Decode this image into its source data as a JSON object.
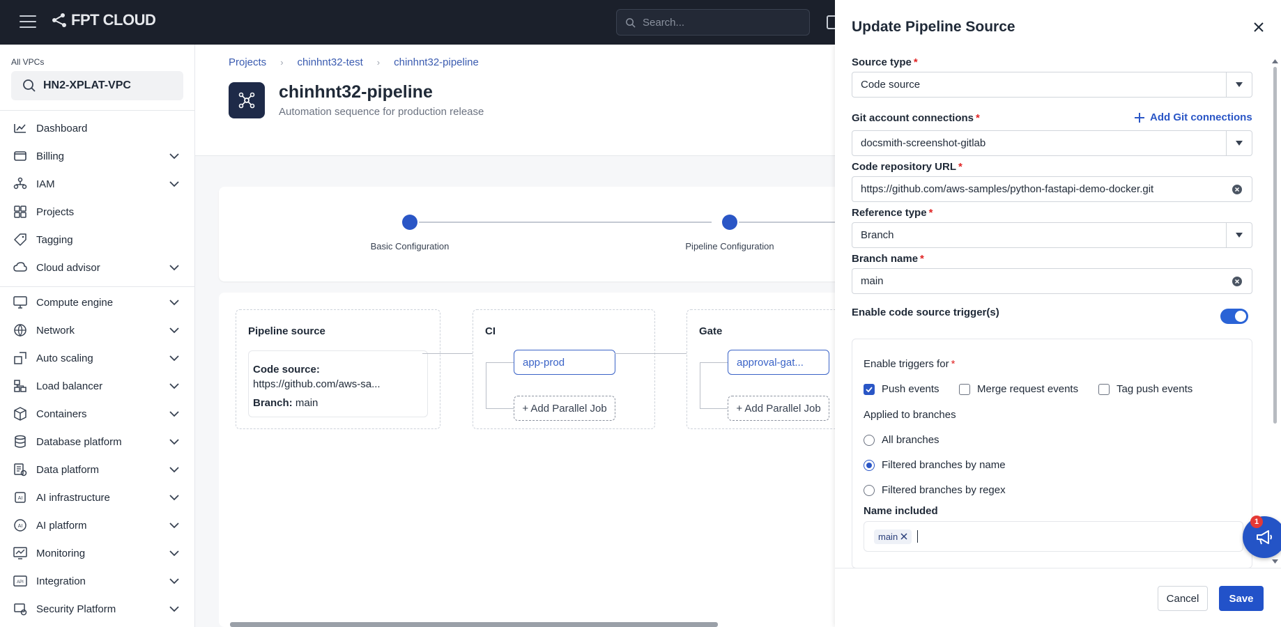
{
  "topbar": {
    "logo": "FPT CLOUD",
    "search_placeholder": "Search..."
  },
  "sidebar": {
    "vpc_label": "All VPCs",
    "vpc_value": "HN2-XPLAT-VPC",
    "items": [
      {
        "label": "Dashboard",
        "icon": "dashboard-icon",
        "expandable": false
      },
      {
        "label": "Billing",
        "icon": "wallet-icon",
        "expandable": true
      },
      {
        "label": "IAM",
        "icon": "people-icon",
        "expandable": true
      },
      {
        "label": "Projects",
        "icon": "grid-icon",
        "expandable": false
      },
      {
        "label": "Tagging",
        "icon": "tag-icon",
        "expandable": false
      },
      {
        "label": "Cloud advisor",
        "icon": "cloud-icon",
        "expandable": true
      },
      {
        "label": "Compute engine",
        "icon": "monitor-icon",
        "expandable": true
      },
      {
        "label": "Network",
        "icon": "globe-icon",
        "expandable": true
      },
      {
        "label": "Auto scaling",
        "icon": "scaling-icon",
        "expandable": true
      },
      {
        "label": "Load balancer",
        "icon": "balancer-icon",
        "expandable": true
      },
      {
        "label": "Containers",
        "icon": "box-icon",
        "expandable": true
      },
      {
        "label": "Database platform",
        "icon": "database-icon",
        "expandable": true
      },
      {
        "label": "Data platform",
        "icon": "data-icon",
        "expandable": true
      },
      {
        "label": "AI infrastructure",
        "icon": "ai-chip-icon",
        "expandable": true
      },
      {
        "label": "AI platform",
        "icon": "ai-icon",
        "expandable": true
      },
      {
        "label": "Monitoring",
        "icon": "chart-icon",
        "expandable": true
      },
      {
        "label": "Integration",
        "icon": "api-icon",
        "expandable": true
      },
      {
        "label": "Security Platform",
        "icon": "security-icon",
        "expandable": true
      }
    ]
  },
  "main": {
    "breadcrumb": [
      "Projects",
      "chinhnt32-test",
      "chinhnt32-pipeline"
    ],
    "title": "chinhnt32-pipeline",
    "subtitle": "Automation sequence for production release",
    "steps": [
      "Basic Configuration",
      "Pipeline Configuration"
    ],
    "stages": {
      "source": {
        "title": "Pipeline source",
        "code_label": "Code source:",
        "code_value": "https://github.com/aws-sa...",
        "branch_label": "Branch:",
        "branch_value": "main"
      },
      "ci": {
        "title": "CI",
        "job": "app-prod",
        "parallel": "+ Add Parallel Job"
      },
      "gate": {
        "title": "Gate",
        "job": "approval-gat...",
        "parallel": "+ Add Parallel Job"
      }
    }
  },
  "drawer": {
    "title": "Update Pipeline Source",
    "source_type_label": "Source type",
    "source_type_value": "Code source",
    "git_label": "Git account connections",
    "add_git": "Add Git connections",
    "git_value": "docsmith-screenshot-gitlab",
    "repo_label": "Code repository URL",
    "repo_value": "https://github.com/aws-samples/python-fastapi-demo-docker.git",
    "ref_label": "Reference type",
    "ref_value": "Branch",
    "branch_label": "Branch name",
    "branch_value": "main",
    "trigger_toggle_label": "Enable code source trigger(s)",
    "trigger_enabled": true,
    "triggers_for_label": "Enable triggers for",
    "triggers": [
      {
        "label": "Push events",
        "checked": true
      },
      {
        "label": "Merge request events",
        "checked": false
      },
      {
        "label": "Tag push events",
        "checked": false
      }
    ],
    "applied_label": "Applied to branches",
    "branch_options": [
      {
        "label": "All branches",
        "selected": false
      },
      {
        "label": "Filtered branches by name",
        "selected": true
      },
      {
        "label": "Filtered branches by regex",
        "selected": false
      }
    ],
    "name_included_label": "Name included",
    "name_included_tags": [
      "main"
    ],
    "cancel": "Cancel",
    "save": "Save"
  },
  "fab": {
    "badge": "1"
  },
  "colors": {
    "primary": "#2252c9",
    "topbar": "#1b202b",
    "required": "#e02424"
  }
}
